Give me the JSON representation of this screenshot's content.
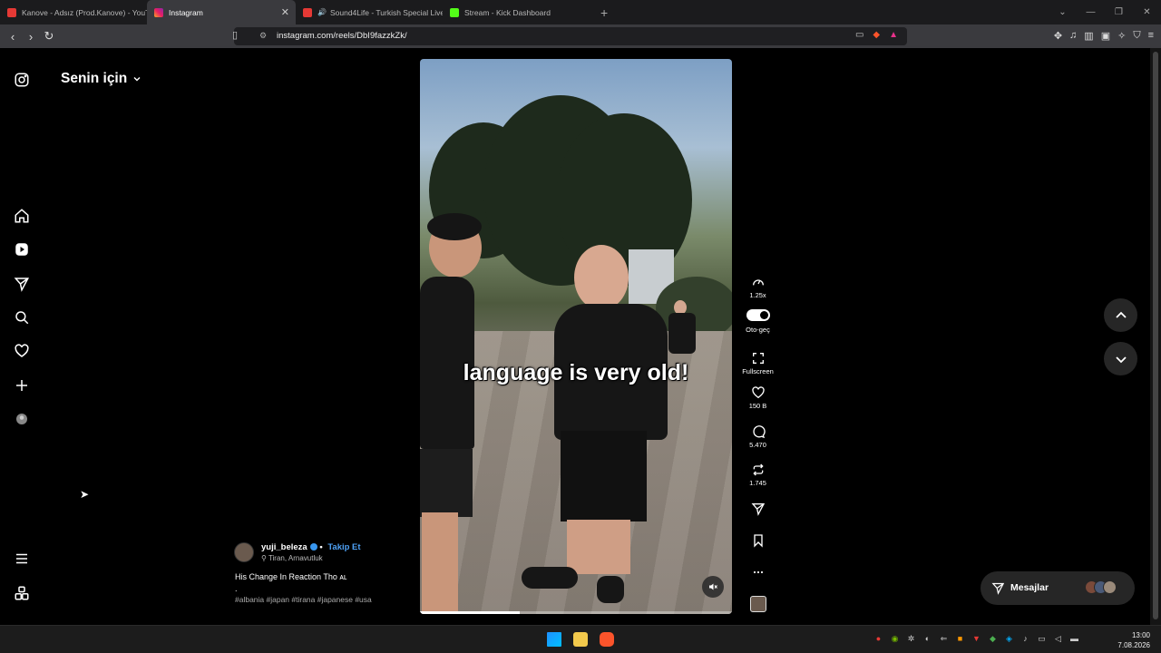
{
  "browser": {
    "tabs": [
      {
        "title": "Kanove - Adsız (Prod.Kanove) - YouTube",
        "active": false
      },
      {
        "title": "Instagram",
        "active": true
      },
      {
        "title": "Sound4Life - Turkish Special Live",
        "active": false
      },
      {
        "title": "Stream - Kick Dashboard",
        "active": false
      }
    ],
    "url": "instagram.com/reels/DbI9fazzkZk/"
  },
  "feed": {
    "title": "Senin için"
  },
  "reel": {
    "caption_overlay": "language is very old!",
    "progress_fraction": 0.32,
    "author": {
      "username": "yuji_beleza",
      "separator": "•",
      "follow_label": "Takip Et",
      "location": "Tiran, Arnavutluk"
    },
    "description": "His Change In Reaction Tho ᴀʟ",
    "description_dot": ".",
    "hashtags": "#albania #japan #tirana #japanese #usa"
  },
  "actions": {
    "speed": "1.25x",
    "autoplay": "Oto-geç",
    "fullscreen": "Fullscreen",
    "likes": "150 B",
    "comments": "5.470",
    "reposts": "1.745"
  },
  "messages": {
    "label": "Mesajlar"
  },
  "taskbar": {
    "time": "13:00",
    "date": "7.08.2026"
  },
  "colors": {
    "accent_blue": "#4ea1f5",
    "background": "#000000",
    "panel": "#262626"
  }
}
